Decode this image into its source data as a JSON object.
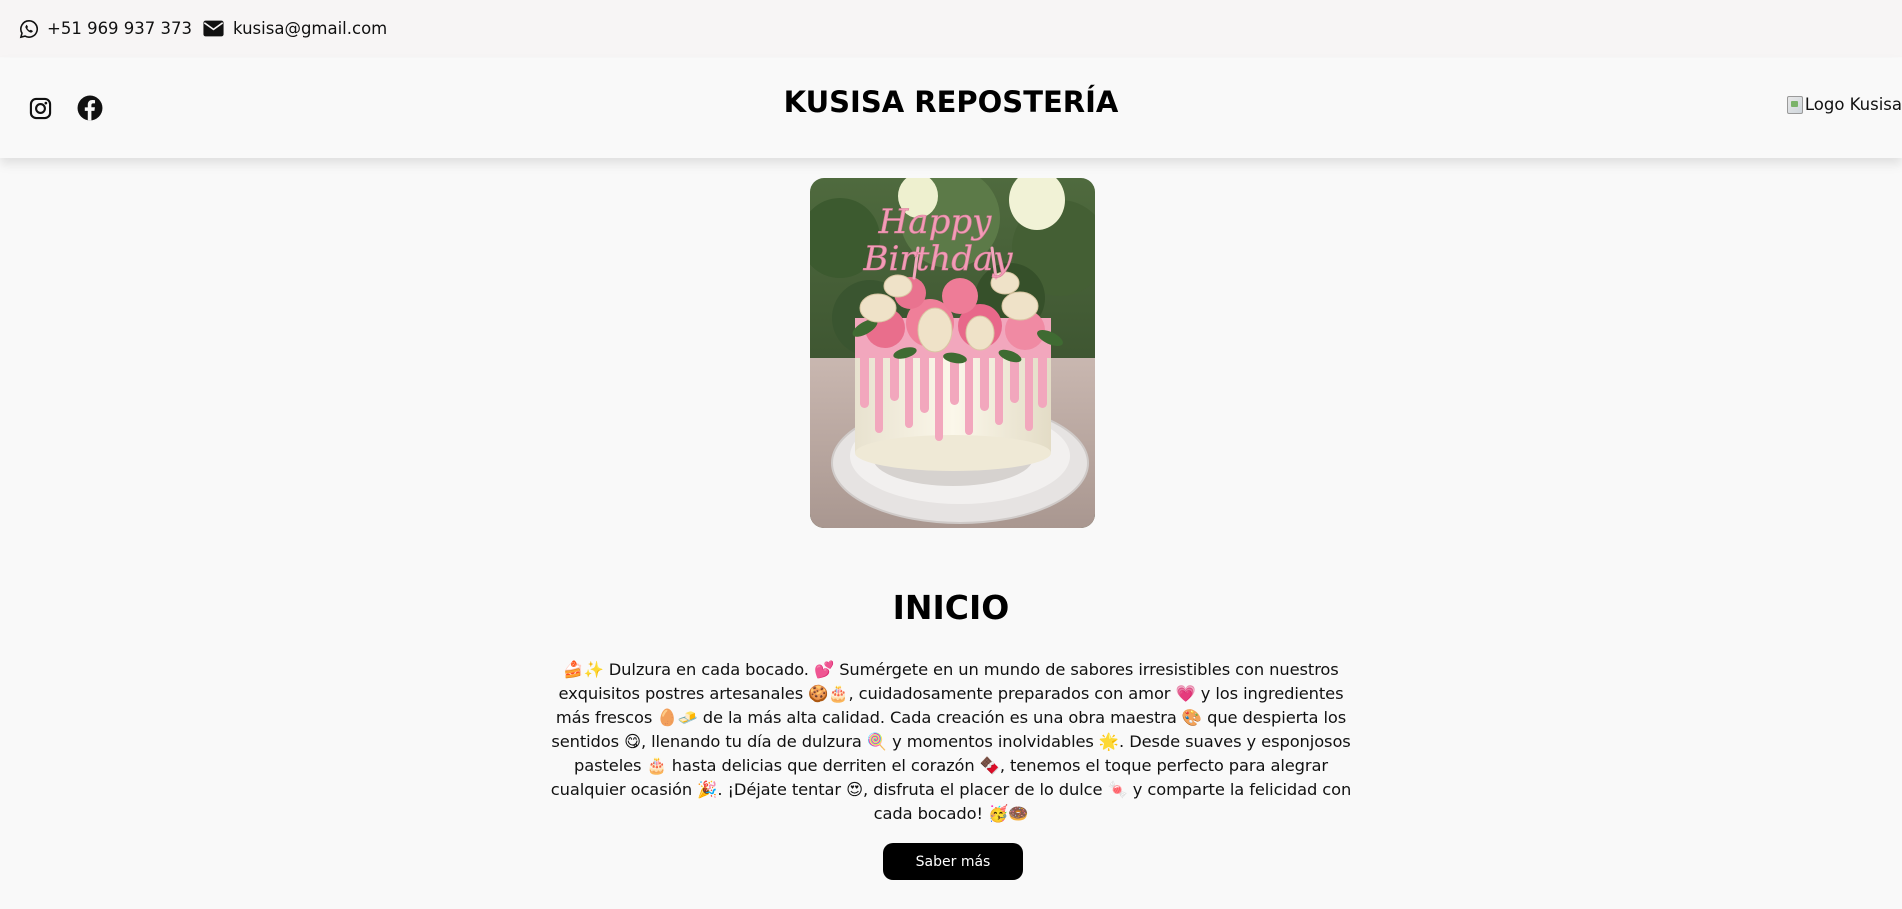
{
  "contact": {
    "phone_icon": "whatsapp-icon",
    "phone": "+51 969 937 373",
    "email_icon": "envelope-icon",
    "email": "kusisa@gmail.com"
  },
  "header": {
    "social": [
      {
        "icon": "instagram-icon"
      },
      {
        "icon": "facebook-icon"
      }
    ],
    "brand": "KUSISA REPOSTERÍA",
    "logo_alt": "Logo Kusisa"
  },
  "hero": {
    "topper_text": "Happy Birthday"
  },
  "main": {
    "title": "INICIO",
    "description": "🍰✨ Dulzura en cada bocado. 💕 Sumérgete en un mundo de sabores irresistibles con nuestros exquisitos postres artesanales 🍪🎂, cuidadosamente preparados con amor 💗 y los ingredientes más frescos 🥚🧈 de la más alta calidad. Cada creación es una obra maestra 🎨 que despierta los sentidos 😋, llenando tu día de dulzura 🍭 y momentos inolvidables 🌟. Desde suaves y esponjosos pasteles 🎂 hasta delicias que derriten el corazón 🍫, tenemos el toque perfecto para alegrar cualquier ocasión 🎉. ¡Déjate tentar 😍, disfruta el placer de lo dulce 🍬 y comparte la felicidad con cada bocado! 🥳🍩",
    "cta_label": "Saber más"
  },
  "colors": {
    "page_bg": "#f9f9f9",
    "topbar_bg": "#f7f5f5",
    "button_bg": "#000000",
    "button_text": "#ffffff",
    "cake_pink": "#f2a7bd"
  }
}
